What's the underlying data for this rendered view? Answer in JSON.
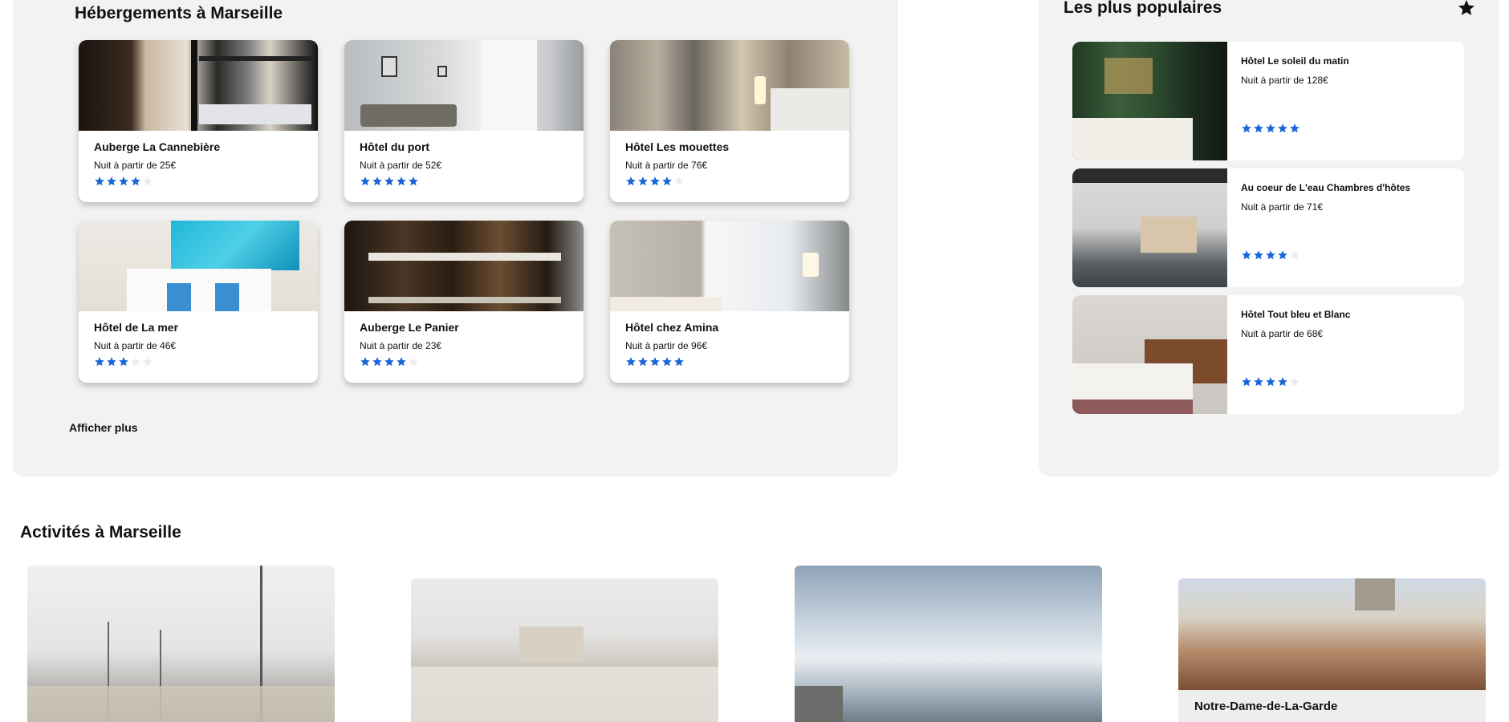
{
  "hebergements": {
    "title": "Hébergements à Marseille",
    "more_label": "Afficher plus",
    "hotels": [
      {
        "name": "Auberge La Cannebière",
        "price": "Nuit à partir de 25€",
        "rating": 4
      },
      {
        "name": "Hôtel du port",
        "price": "Nuit à partir de 52€",
        "rating": 5
      },
      {
        "name": "Hôtel Les mouettes",
        "price": "Nuit à partir de 76€",
        "rating": 4
      },
      {
        "name": "Hôtel de La mer",
        "price": "Nuit à partir de 46€",
        "rating": 3
      },
      {
        "name": "Auberge Le Panier",
        "price": "Nuit à partir de 23€",
        "rating": 4
      },
      {
        "name": "Hôtel chez Amina",
        "price": "Nuit à partir de 96€",
        "rating": 5
      }
    ]
  },
  "populaires": {
    "title": "Les plus populaires",
    "icon": "star-icon",
    "items": [
      {
        "name": "Hôtel Le soleil du matin",
        "price": "Nuit à partir de 128€",
        "rating": 5
      },
      {
        "name": "Au coeur de L'eau Chambres d'hôtes",
        "price": "Nuit à partir de 71€",
        "rating": 4
      },
      {
        "name": "Hôtel Tout bleu et Blanc",
        "price": "Nuit à partir de 68€",
        "rating": 4
      }
    ]
  },
  "activites": {
    "title": "Activités à Marseille",
    "items": [
      {
        "caption": ""
      },
      {
        "caption": ""
      },
      {
        "caption": ""
      },
      {
        "caption": "Notre-Dame-de-La-Garde"
      }
    ]
  },
  "colors": {
    "star_filled": "#1a66d6",
    "star_empty": "#ececec",
    "panel_bg": "#f2f2f2"
  }
}
